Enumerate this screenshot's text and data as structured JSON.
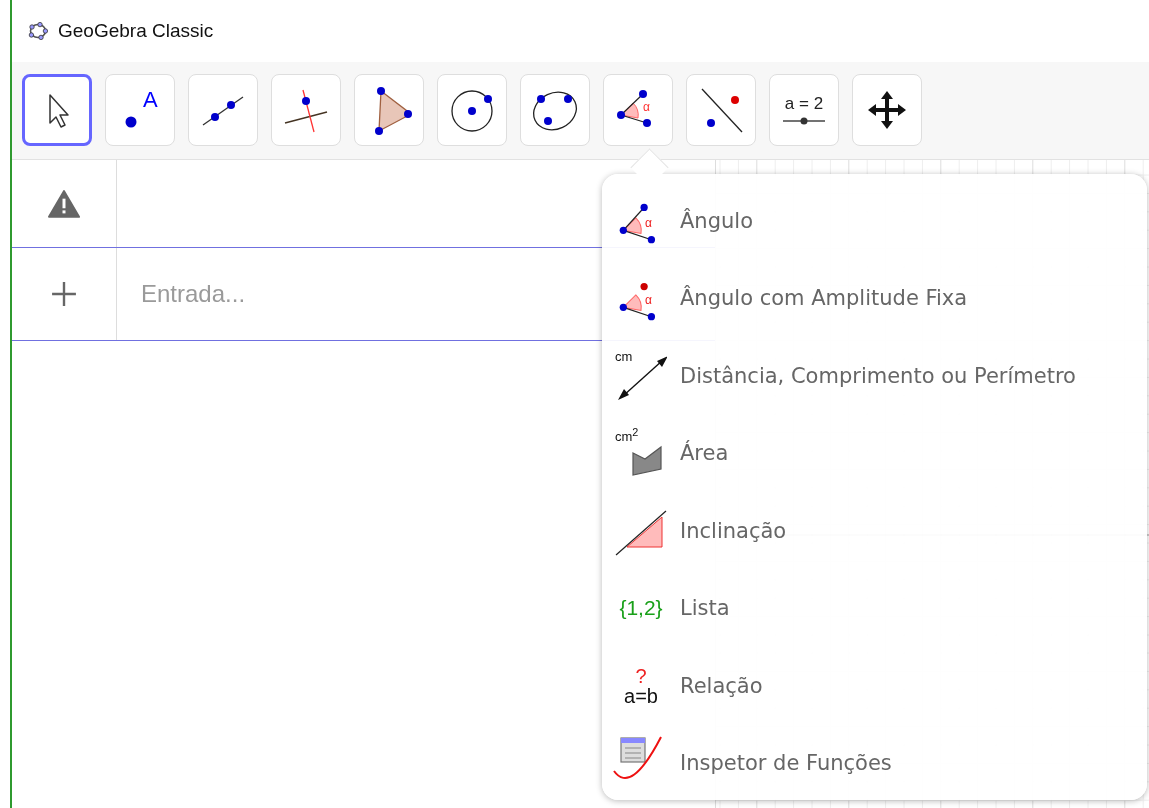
{
  "window": {
    "title": "GeoGebra Classic"
  },
  "toolbar": {
    "tools": [
      {
        "kind": "move",
        "selected": true
      },
      {
        "kind": "point",
        "selected": false,
        "icon_text": "A"
      },
      {
        "kind": "line",
        "selected": false
      },
      {
        "kind": "perpendicular",
        "selected": false
      },
      {
        "kind": "polygon",
        "selected": false
      },
      {
        "kind": "circle",
        "selected": false
      },
      {
        "kind": "conic",
        "selected": false
      },
      {
        "kind": "angle",
        "selected": false,
        "icon_text": "α"
      },
      {
        "kind": "reflect",
        "selected": false
      },
      {
        "kind": "slider",
        "selected": false,
        "icon_text": "a = 2"
      },
      {
        "kind": "move_view",
        "selected": false
      }
    ]
  },
  "algebra_view": {
    "input": {
      "placeholder": "Entrada..."
    }
  },
  "tool_menu": {
    "items": [
      {
        "kind": "angle",
        "label": "Ângulo",
        "icon_text": "α"
      },
      {
        "kind": "fixed_angle",
        "label": "Ângulo com Amplitude Fixa",
        "icon_text": "α"
      },
      {
        "kind": "distance",
        "label": "Distância, Comprimento ou Perímetro",
        "icon_text": "cm"
      },
      {
        "kind": "area",
        "label": "Área",
        "icon_text": "cm$^{2}$"
      },
      {
        "kind": "slope",
        "label": "Inclinação"
      },
      {
        "kind": "list",
        "label": "Lista",
        "icon_text": "{1,2}"
      },
      {
        "kind": "relation",
        "label": "Relação",
        "icon_text": "?",
        "icon_text_2": "a=b"
      },
      {
        "kind": "function_inspector",
        "label": "Inspetor de Funções"
      }
    ]
  }
}
